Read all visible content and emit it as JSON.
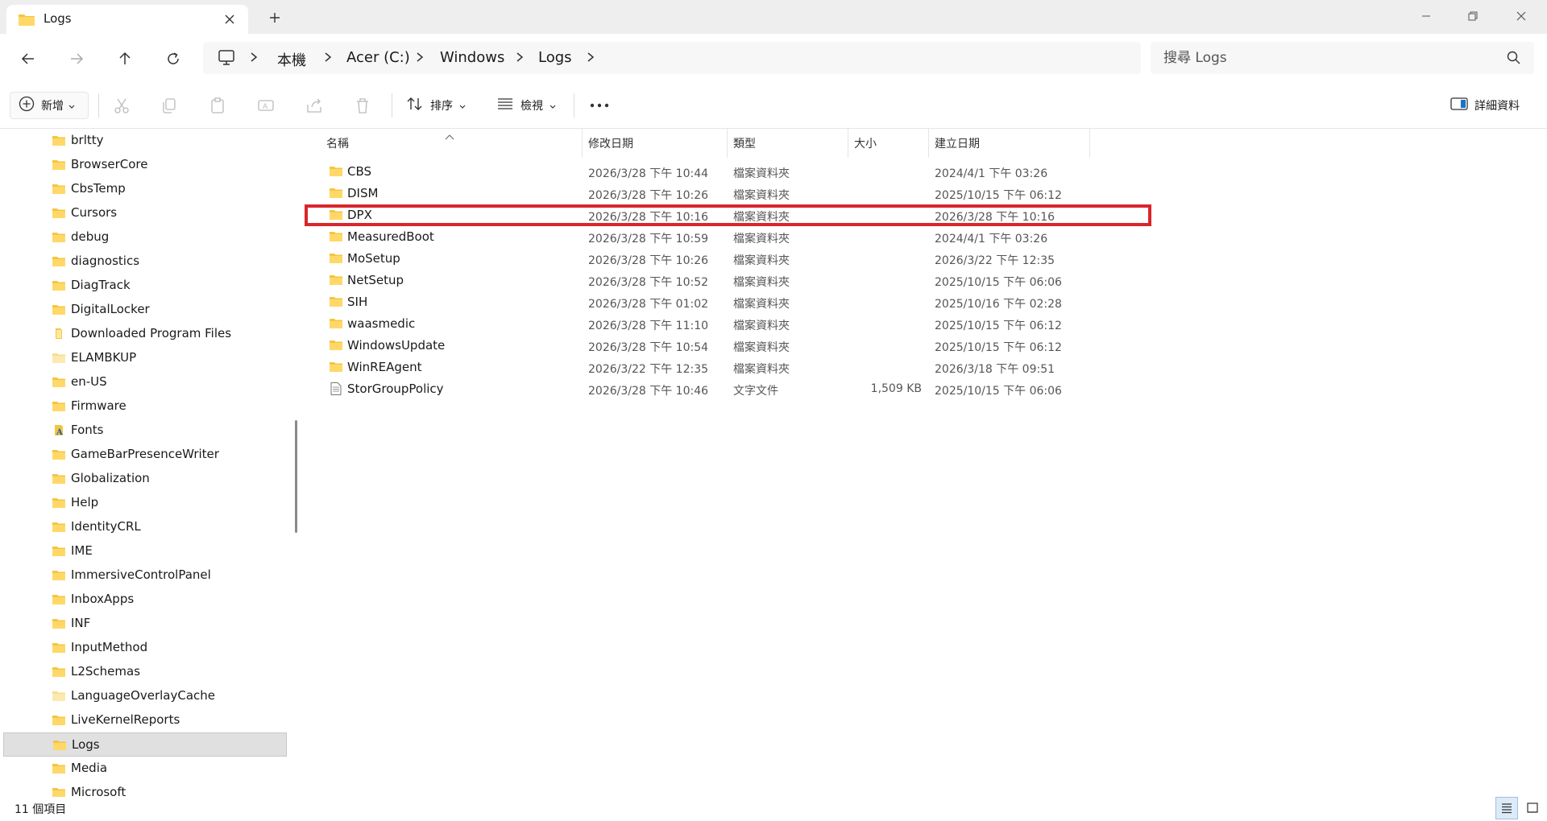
{
  "window": {
    "tab_title": "Logs",
    "tab_icon": "folder-icon",
    "accent": "#1a73c7",
    "folder_color": "#f4c542",
    "highlight_color": "#d9262c"
  },
  "breadcrumb": {
    "items": [
      "本機",
      "Acer (C:)",
      "Windows",
      "Logs"
    ]
  },
  "search": {
    "placeholder": "搜尋 Logs"
  },
  "toolbar": {
    "new_label": "新增",
    "sort_label": "排序",
    "view_label": "檢視",
    "details_label": "詳細資料"
  },
  "sidebar": {
    "items": [
      {
        "label": "brltty",
        "icon": "folder-icon"
      },
      {
        "label": "BrowserCore",
        "icon": "folder-icon"
      },
      {
        "label": "CbsTemp",
        "icon": "folder-icon"
      },
      {
        "label": "Cursors",
        "icon": "folder-icon"
      },
      {
        "label": "debug",
        "icon": "folder-icon"
      },
      {
        "label": "diagnostics",
        "icon": "folder-icon"
      },
      {
        "label": "DiagTrack",
        "icon": "folder-icon"
      },
      {
        "label": "DigitalLocker",
        "icon": "folder-icon"
      },
      {
        "label": "Downloaded Program Files",
        "icon": "special-folder-icon"
      },
      {
        "label": "ELAMBKUP",
        "icon": "folder-light-icon"
      },
      {
        "label": "en-US",
        "icon": "folder-icon"
      },
      {
        "label": "Firmware",
        "icon": "folder-icon"
      },
      {
        "label": "Fonts",
        "icon": "fonts-folder-icon"
      },
      {
        "label": "GameBarPresenceWriter",
        "icon": "folder-icon"
      },
      {
        "label": "Globalization",
        "icon": "folder-icon"
      },
      {
        "label": "Help",
        "icon": "folder-icon"
      },
      {
        "label": "IdentityCRL",
        "icon": "folder-icon"
      },
      {
        "label": "IME",
        "icon": "folder-icon"
      },
      {
        "label": "ImmersiveControlPanel",
        "icon": "folder-icon"
      },
      {
        "label": "InboxApps",
        "icon": "folder-icon"
      },
      {
        "label": "INF",
        "icon": "folder-icon"
      },
      {
        "label": "InputMethod",
        "icon": "folder-icon"
      },
      {
        "label": "L2Schemas",
        "icon": "folder-icon"
      },
      {
        "label": "LanguageOverlayCache",
        "icon": "folder-light-icon"
      },
      {
        "label": "LiveKernelReports",
        "icon": "folder-icon"
      },
      {
        "label": "Logs",
        "icon": "folder-icon"
      },
      {
        "label": "Media",
        "icon": "folder-icon"
      },
      {
        "label": "Microsoft",
        "icon": "folder-icon"
      }
    ]
  },
  "columns": {
    "name": "名稱",
    "modified": "修改日期",
    "type": "類型",
    "size": "大小",
    "created": "建立日期"
  },
  "files": [
    {
      "name": "CBS",
      "modified": "2026/3/28 下午 10:44",
      "type": "檔案資料夾",
      "size": "",
      "created": "2024/4/1 下午 03:26",
      "icon": "folder-icon"
    },
    {
      "name": "DISM",
      "modified": "2026/3/28 下午 10:26",
      "type": "檔案資料夾",
      "size": "",
      "created": "2025/10/15 下午 06:12",
      "icon": "folder-icon"
    },
    {
      "name": "DPX",
      "modified": "2026/3/28 下午 10:16",
      "type": "檔案資料夾",
      "size": "",
      "created": "2026/3/28 下午 10:16",
      "icon": "folder-icon"
    },
    {
      "name": "MeasuredBoot",
      "modified": "2026/3/28 下午 10:59",
      "type": "檔案資料夾",
      "size": "",
      "created": "2024/4/1 下午 03:26",
      "icon": "folder-icon"
    },
    {
      "name": "MoSetup",
      "modified": "2026/3/28 下午 10:26",
      "type": "檔案資料夾",
      "size": "",
      "created": "2026/3/22 下午 12:35",
      "icon": "folder-icon"
    },
    {
      "name": "NetSetup",
      "modified": "2026/3/28 下午 10:52",
      "type": "檔案資料夾",
      "size": "",
      "created": "2025/10/15 下午 06:06",
      "icon": "folder-icon"
    },
    {
      "name": "SIH",
      "modified": "2026/3/28 下午 01:02",
      "type": "檔案資料夾",
      "size": "",
      "created": "2025/10/16 下午 02:28",
      "icon": "folder-icon"
    },
    {
      "name": "waasmedic",
      "modified": "2026/3/28 下午 11:10",
      "type": "檔案資料夾",
      "size": "",
      "created": "2025/10/15 下午 06:12",
      "icon": "folder-icon"
    },
    {
      "name": "WindowsUpdate",
      "modified": "2026/3/28 下午 10:54",
      "type": "檔案資料夾",
      "size": "",
      "created": "2025/10/15 下午 06:12",
      "icon": "folder-icon"
    },
    {
      "name": "WinREAgent",
      "modified": "2026/3/22 下午 12:35",
      "type": "檔案資料夾",
      "size": "",
      "created": "2026/3/18 下午 09:51",
      "icon": "folder-icon"
    },
    {
      "name": "StorGroupPolicy",
      "modified": "2026/3/28 下午 10:46",
      "type": "文字文件",
      "size": "1,509 KB",
      "created": "2025/10/15 下午 06:06",
      "icon": "text-file-icon"
    }
  ],
  "status": {
    "item_count": "11 個項目"
  }
}
